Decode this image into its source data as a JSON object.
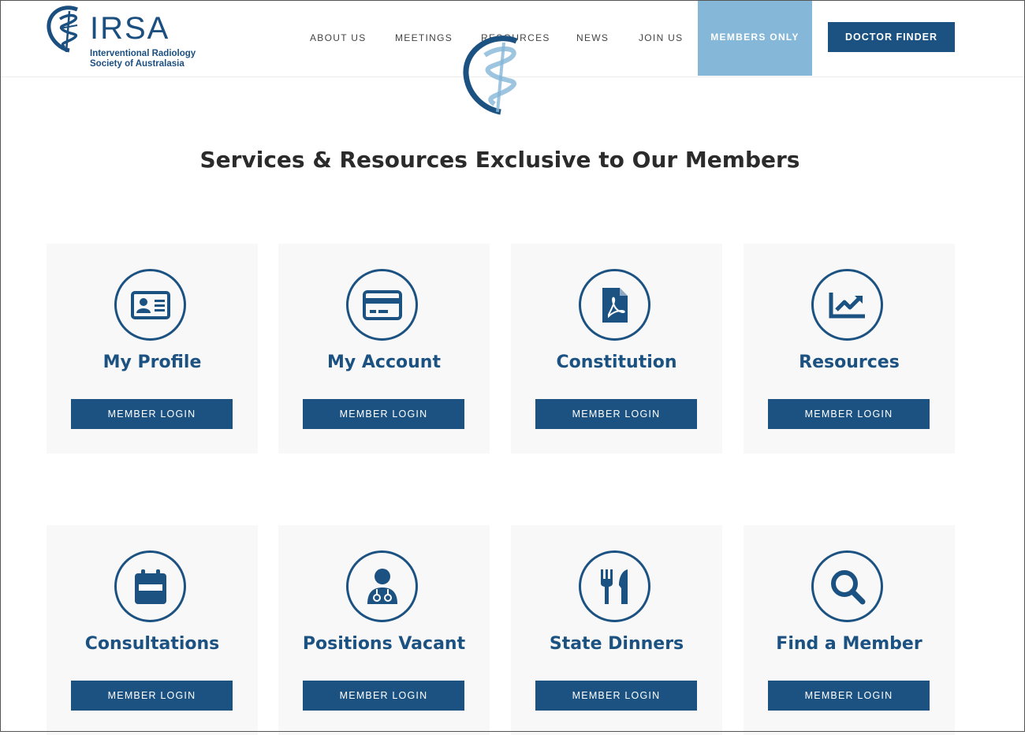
{
  "brand": {
    "name": "IRSA",
    "subtitle_line1": "Interventional Radiology",
    "subtitle_line2": "Society of Australasia",
    "primary_color": "#1c5282",
    "accent_color": "#85b7d8"
  },
  "nav": {
    "items": [
      {
        "label": "ABOUT US"
      },
      {
        "label": "MEETINGS"
      },
      {
        "label": "RESOURCES"
      },
      {
        "label": "NEWS"
      },
      {
        "label": "JOIN US"
      }
    ],
    "members_only": "MEMBERS ONLY",
    "doctor_finder": "DOCTOR FINDER"
  },
  "main": {
    "headline": "Services & Resources Exclusive to Our Members",
    "cards": [
      {
        "title": "My Profile",
        "icon": "id-card-icon",
        "button": "MEMBER LOGIN"
      },
      {
        "title": "My Account",
        "icon": "credit-card-icon",
        "button": "MEMBER LOGIN"
      },
      {
        "title": "Constitution",
        "icon": "pdf-file-icon",
        "button": "MEMBER LOGIN"
      },
      {
        "title": "Resources",
        "icon": "chart-line-icon",
        "button": "MEMBER LOGIN"
      },
      {
        "title": "Consultations",
        "icon": "calendar-icon",
        "button": "MEMBER LOGIN"
      },
      {
        "title": "Positions Vacant",
        "icon": "doctor-icon",
        "button": "MEMBER LOGIN"
      },
      {
        "title": "State Dinners",
        "icon": "utensils-icon",
        "button": "MEMBER LOGIN"
      },
      {
        "title": "Find a Member",
        "icon": "search-icon",
        "button": "MEMBER LOGIN"
      }
    ]
  }
}
